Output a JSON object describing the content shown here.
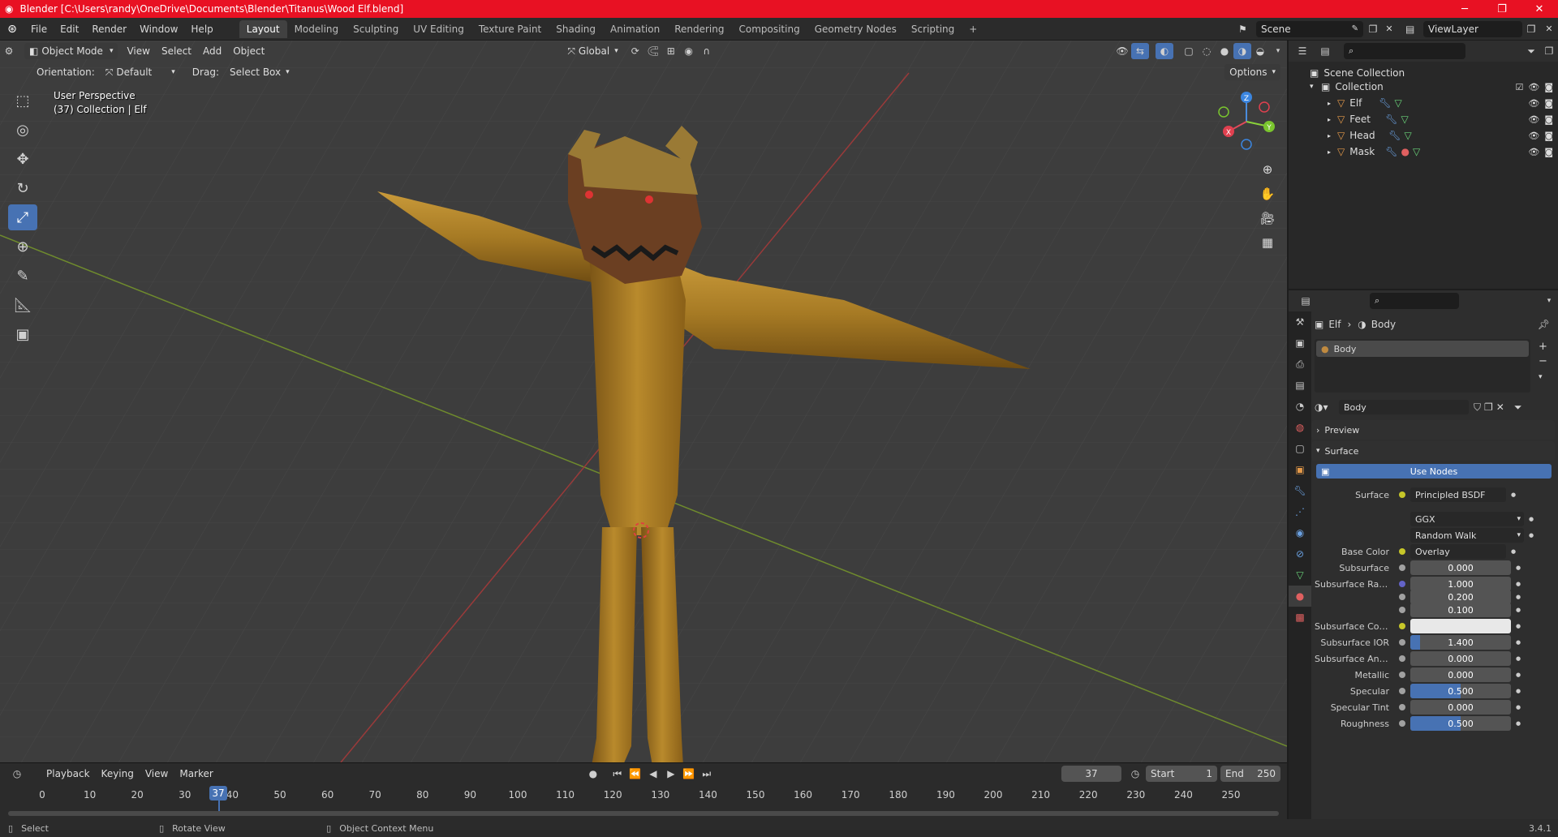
{
  "titlebar": {
    "title": "Blender [C:\\Users\\randy\\OneDrive\\Documents\\Blender\\Titanus\\Wood Elf.blend]",
    "minimize": "─",
    "maximize": "❐",
    "close": "✕"
  },
  "menu": [
    "File",
    "Edit",
    "Render",
    "Window",
    "Help"
  ],
  "workspaces": [
    {
      "label": "Layout",
      "active": true
    },
    {
      "label": "Modeling"
    },
    {
      "label": "Sculpting"
    },
    {
      "label": "UV Editing"
    },
    {
      "label": "Texture Paint"
    },
    {
      "label": "Shading"
    },
    {
      "label": "Animation"
    },
    {
      "label": "Rendering"
    },
    {
      "label": "Compositing"
    },
    {
      "label": "Geometry Nodes"
    },
    {
      "label": "Scripting"
    }
  ],
  "scene": {
    "name": "Scene",
    "view_layer": "ViewLayer"
  },
  "viewport": {
    "mode": "Object Mode",
    "menus": [
      "View",
      "Select",
      "Add",
      "Object"
    ],
    "transform_orientation": "Global",
    "orientation_label": "Orientation:",
    "orientation_value": "Default",
    "drag_label": "Drag:",
    "drag_value": "Select Box",
    "options": "Options",
    "info_line1": "User Perspective",
    "info_line2": "(37) Collection | Elf",
    "gizmo": {
      "z": "Z",
      "y": "Y",
      "x": "X"
    }
  },
  "outliner": {
    "search_placeholder": "",
    "scene_collection": "Scene Collection",
    "collection": "Collection",
    "objects": [
      "Elf",
      "Feet",
      "Head",
      "Mask"
    ]
  },
  "properties": {
    "breadcrumb_object": "Elf",
    "breadcrumb_material": "Body",
    "slot_name": "Body",
    "material_name": "Body",
    "preview_label": "Preview",
    "surface_label": "Surface",
    "use_nodes": "Use Nodes",
    "rows": [
      {
        "label": "Surface",
        "value": "Principled BSDF",
        "kind": "select"
      },
      {
        "label": "",
        "value": "GGX",
        "kind": "dropdown"
      },
      {
        "label": "",
        "value": "Random Walk",
        "kind": "dropdown"
      },
      {
        "label": "Base Color",
        "value": "Overlay",
        "kind": "select"
      },
      {
        "label": "Subsurface",
        "value": "0.000",
        "kind": "number",
        "fill": 0
      },
      {
        "label": "Subsurface Radius",
        "value": "1.000",
        "kind": "number",
        "fill": 0
      },
      {
        "label": "",
        "value": "0.200",
        "kind": "number",
        "fill": 0
      },
      {
        "label": "",
        "value": "0.100",
        "kind": "number",
        "fill": 0
      },
      {
        "label": "Subsurface Color",
        "value": "",
        "kind": "color"
      },
      {
        "label": "Subsurface IOR",
        "value": "1.400",
        "kind": "number",
        "fill": 0.1
      },
      {
        "label": "Subsurface Aniso...",
        "value": "0.000",
        "kind": "number",
        "fill": 0
      },
      {
        "label": "Metallic",
        "value": "0.000",
        "kind": "number",
        "fill": 0
      },
      {
        "label": "Specular",
        "value": "0.500",
        "kind": "number",
        "fill": 0.5
      },
      {
        "label": "Specular Tint",
        "value": "0.000",
        "kind": "number",
        "fill": 0
      },
      {
        "label": "Roughness",
        "value": "0.500",
        "kind": "number",
        "fill": 0.5
      }
    ]
  },
  "timeline": {
    "menus": [
      "Playback",
      "Keying",
      "View",
      "Marker"
    ],
    "current_frame": "37",
    "start_label": "Start",
    "start": "1",
    "end_label": "End",
    "end": "250",
    "ticks": [
      "0",
      "10",
      "20",
      "30",
      "40",
      "50",
      "60",
      "70",
      "80",
      "90",
      "100",
      "110",
      "120",
      "130",
      "140",
      "150",
      "160",
      "170",
      "180",
      "190",
      "200",
      "210",
      "220",
      "230",
      "240",
      "250"
    ]
  },
  "statusbar": {
    "select": "Select",
    "rotate": "Rotate View",
    "context": "Object Context Menu",
    "version": "3.4.1"
  },
  "colors": {
    "accent": "#4772b3",
    "titlebar": "#e81123",
    "wood": "#a6761f"
  }
}
